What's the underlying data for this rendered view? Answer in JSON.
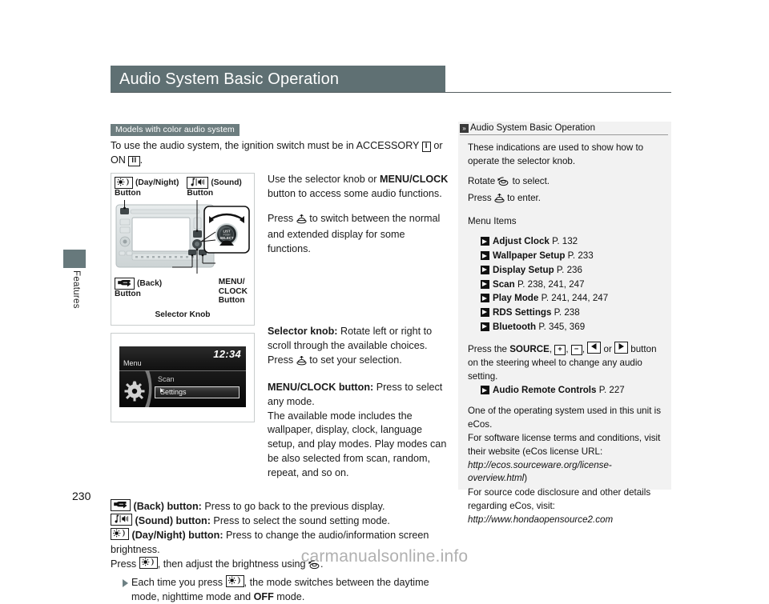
{
  "page": {
    "title": "Audio System Basic Operation",
    "page_number": "230",
    "side_tab": "Features",
    "watermark": "carmanualsonline.info",
    "accent_color": "#5f7073",
    "badge_color": "#6d7d7f",
    "sidebar_bg": "#f2f2f2"
  },
  "main": {
    "model_badge": "Models with color audio system",
    "lead_prefix": "To use the audio system, the ignition switch must be in ACCESSORY",
    "lead_key_acc": "I",
    "lead_mid": "or ON",
    "lead_key_on": "II",
    "lead_suffix": ".",
    "figure1": {
      "callout_daynight_icon": "sun-moon-icon",
      "callout_daynight_label": "(Day/Night)",
      "callout_daynight_button": "Button",
      "callout_sound_icon": "note-speaker-icon",
      "callout_sound_label": "(Sound)",
      "callout_sound_button": "Button",
      "callout_back_icon": "back-arrow-icon",
      "callout_back_label": "(Back)",
      "callout_back_button": "Button",
      "callout_selector_knob": "Selector Knob",
      "callout_menuclock_line1": "MENU/",
      "callout_menuclock_line2": "CLOCK",
      "callout_menuclock_line3": "Button",
      "knob_text_line1": "LIST",
      "knob_text_line2": "PUSH",
      "knob_text_line3": "SELECT"
    },
    "figure2": {
      "clock": "12:34",
      "menu_label": "Menu",
      "item_scan": "Scan",
      "item_settings": "Settings"
    },
    "right_text": {
      "para1_a": "Use the selector knob or ",
      "para1_bold": "MENU/CLOCK",
      "para1_b": " button to access some audio functions.",
      "para2_a": "Press ",
      "para2_icon": "press-knob-icon",
      "para2_b": " to switch between the normal and extended display for some functions."
    },
    "descriptions": {
      "selector_bold": "Selector knob:",
      "selector_text_a": " Rotate left or right to scroll through the available choices. Press ",
      "selector_icon": "press-knob-icon",
      "selector_text_b": " to set your selection.",
      "menuclock_bold": "MENU/CLOCK button:",
      "menuclock_text": " Press to select any mode.",
      "modes_text": "The available mode includes the wallpaper, display, clock, language setup, and play modes. Play modes can be also selected from scan, random, repeat, and so on."
    },
    "button_list": {
      "back_bold": "(Back) button:",
      "back_text": " Press to go back to the previous display.",
      "sound_bold": "(Sound) button:",
      "sound_text": " Press to select the sound setting mode.",
      "daynight_bold": "(Day/Night) button:",
      "daynight_text": " Press to change the audio/information screen brightness.",
      "press_a": "Press ",
      "press_b": ", then adjust the brightness using ",
      "press_c": ".",
      "bullet_a": "Each time you press ",
      "bullet_b": ", the mode switches between the daytime mode, nighttime mode and ",
      "bullet_bold": "OFF",
      "bullet_c": " mode."
    }
  },
  "sidebar": {
    "header_icon": "double-chevron-icon",
    "header_title": "Audio System Basic Operation",
    "intro": "These indications are used to show how to operate the selector knob.",
    "rotate_a": "Rotate ",
    "rotate_icon": "rotate-knob-icon",
    "rotate_b": " to select.",
    "press_a": "Press ",
    "press_icon": "press-knob-icon",
    "press_b": " to enter.",
    "menu_items_header": "Menu Items",
    "menu_items": [
      {
        "name": "Adjust Clock",
        "page": "P. 132"
      },
      {
        "name": "Wallpaper Setup",
        "page": "P. 233"
      },
      {
        "name": "Display Setup",
        "page": "P. 236"
      },
      {
        "name": "Scan",
        "page": "P. 238, 241, 247"
      },
      {
        "name": "Play Mode",
        "page": "P. 241, 244, 247"
      },
      {
        "name": "RDS Settings",
        "page": "P. 238"
      },
      {
        "name": "Bluetooth",
        "page": "P. 345, 369"
      }
    ],
    "source_a": "Press the ",
    "source_bold": "SOURCE",
    "source_b": ", ",
    "source_key_plus": "+",
    "source_c": ", ",
    "source_key_minus": "−",
    "source_d": ", ",
    "source_key_left": "left-arrow-icon",
    "source_e": " or ",
    "source_key_right": "right-arrow-icon",
    "source_f": " button on the steering wheel to change any audio setting.",
    "remote_ref_name": "Audio Remote Controls",
    "remote_ref_page": "P. 227",
    "ecos_1": "One of the operating system used in this unit is eCos.",
    "ecos_2a": "For software license terms and conditions, visit their website (eCos license URL: ",
    "ecos_2url": "http://ecos.sourceware.org/license-overview.html",
    "ecos_2b": ")",
    "ecos_3a": "For source code disclosure and other details regarding eCos, visit: ",
    "ecos_3url": "http://www.hondaopensource2.com"
  }
}
